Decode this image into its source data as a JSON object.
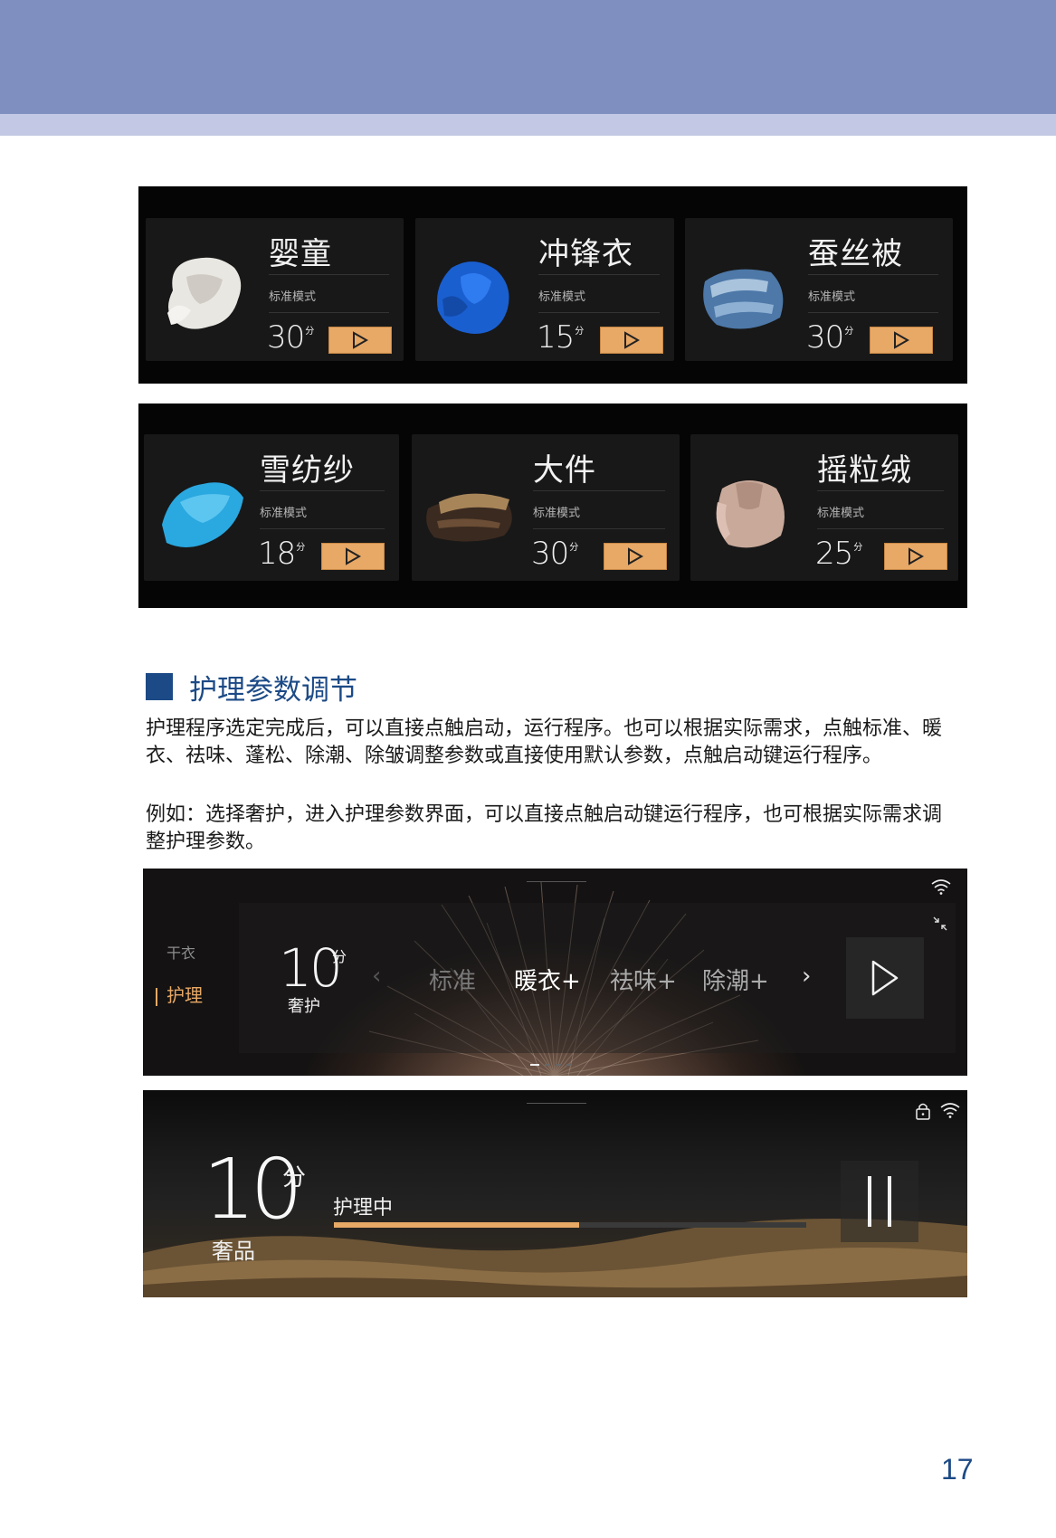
{
  "programs_row1": [
    {
      "name": "婴童",
      "mode": "标准模式",
      "time": "30",
      "unit": "分",
      "garment": "white"
    },
    {
      "name": "冲锋衣",
      "mode": "标准模式",
      "time": "15",
      "unit": "分",
      "garment": "blue"
    },
    {
      "name": "蚕丝被",
      "mode": "标准模式",
      "time": "30",
      "unit": "分",
      "garment": "quilt"
    }
  ],
  "programs_row2": [
    {
      "name": "雪纺纱",
      "mode": "标准模式",
      "time": "18",
      "unit": "分",
      "garment": "chiffon"
    },
    {
      "name": "大件",
      "mode": "标准模式",
      "time": "30",
      "unit": "分",
      "garment": "bulky"
    },
    {
      "name": "摇粒绒",
      "mode": "标准模式",
      "time": "25",
      "unit": "分",
      "garment": "fleece"
    }
  ],
  "section": {
    "title": "护理参数调节",
    "paragraph1": "护理程序选定完成后，可以直接点触启动，运行程序。也可以根据实际需求，点触标准、暖衣、祛味、蓬松、除潮、除皱调整参数或直接使用默认参数，点触启动键运行程序。",
    "paragraph2": "例如：选择奢护，进入护理参数界面，可以直接点触启动键运行程序，也可根据实际需求调整护理参数。"
  },
  "screen1": {
    "side_items": [
      "干衣",
      "护理"
    ],
    "selected_side": "护理",
    "time": "10",
    "time_unit": "分",
    "program": "奢护",
    "options": [
      {
        "label": "标准",
        "state": "dim"
      },
      {
        "label": "暖衣+",
        "state": "active"
      },
      {
        "label": "祛味+",
        "state": "normal"
      },
      {
        "label": "除潮+",
        "state": "normal"
      }
    ],
    "icons": [
      "chevron-left-icon",
      "chevron-right-icon",
      "play-icon",
      "wifi-icon",
      "shrink-icon"
    ]
  },
  "screen2": {
    "time": "10",
    "time_unit": "分",
    "program": "奢品",
    "status": "护理中",
    "progress": 0.52,
    "icons": [
      "pause-icon",
      "lock-icon",
      "wifi-icon"
    ]
  },
  "colors": {
    "accent": "#e8a866",
    "brand": "#1c4a86",
    "header": "#7f8fbf",
    "header_strip": "#c3c9e4"
  },
  "page_number": "17"
}
